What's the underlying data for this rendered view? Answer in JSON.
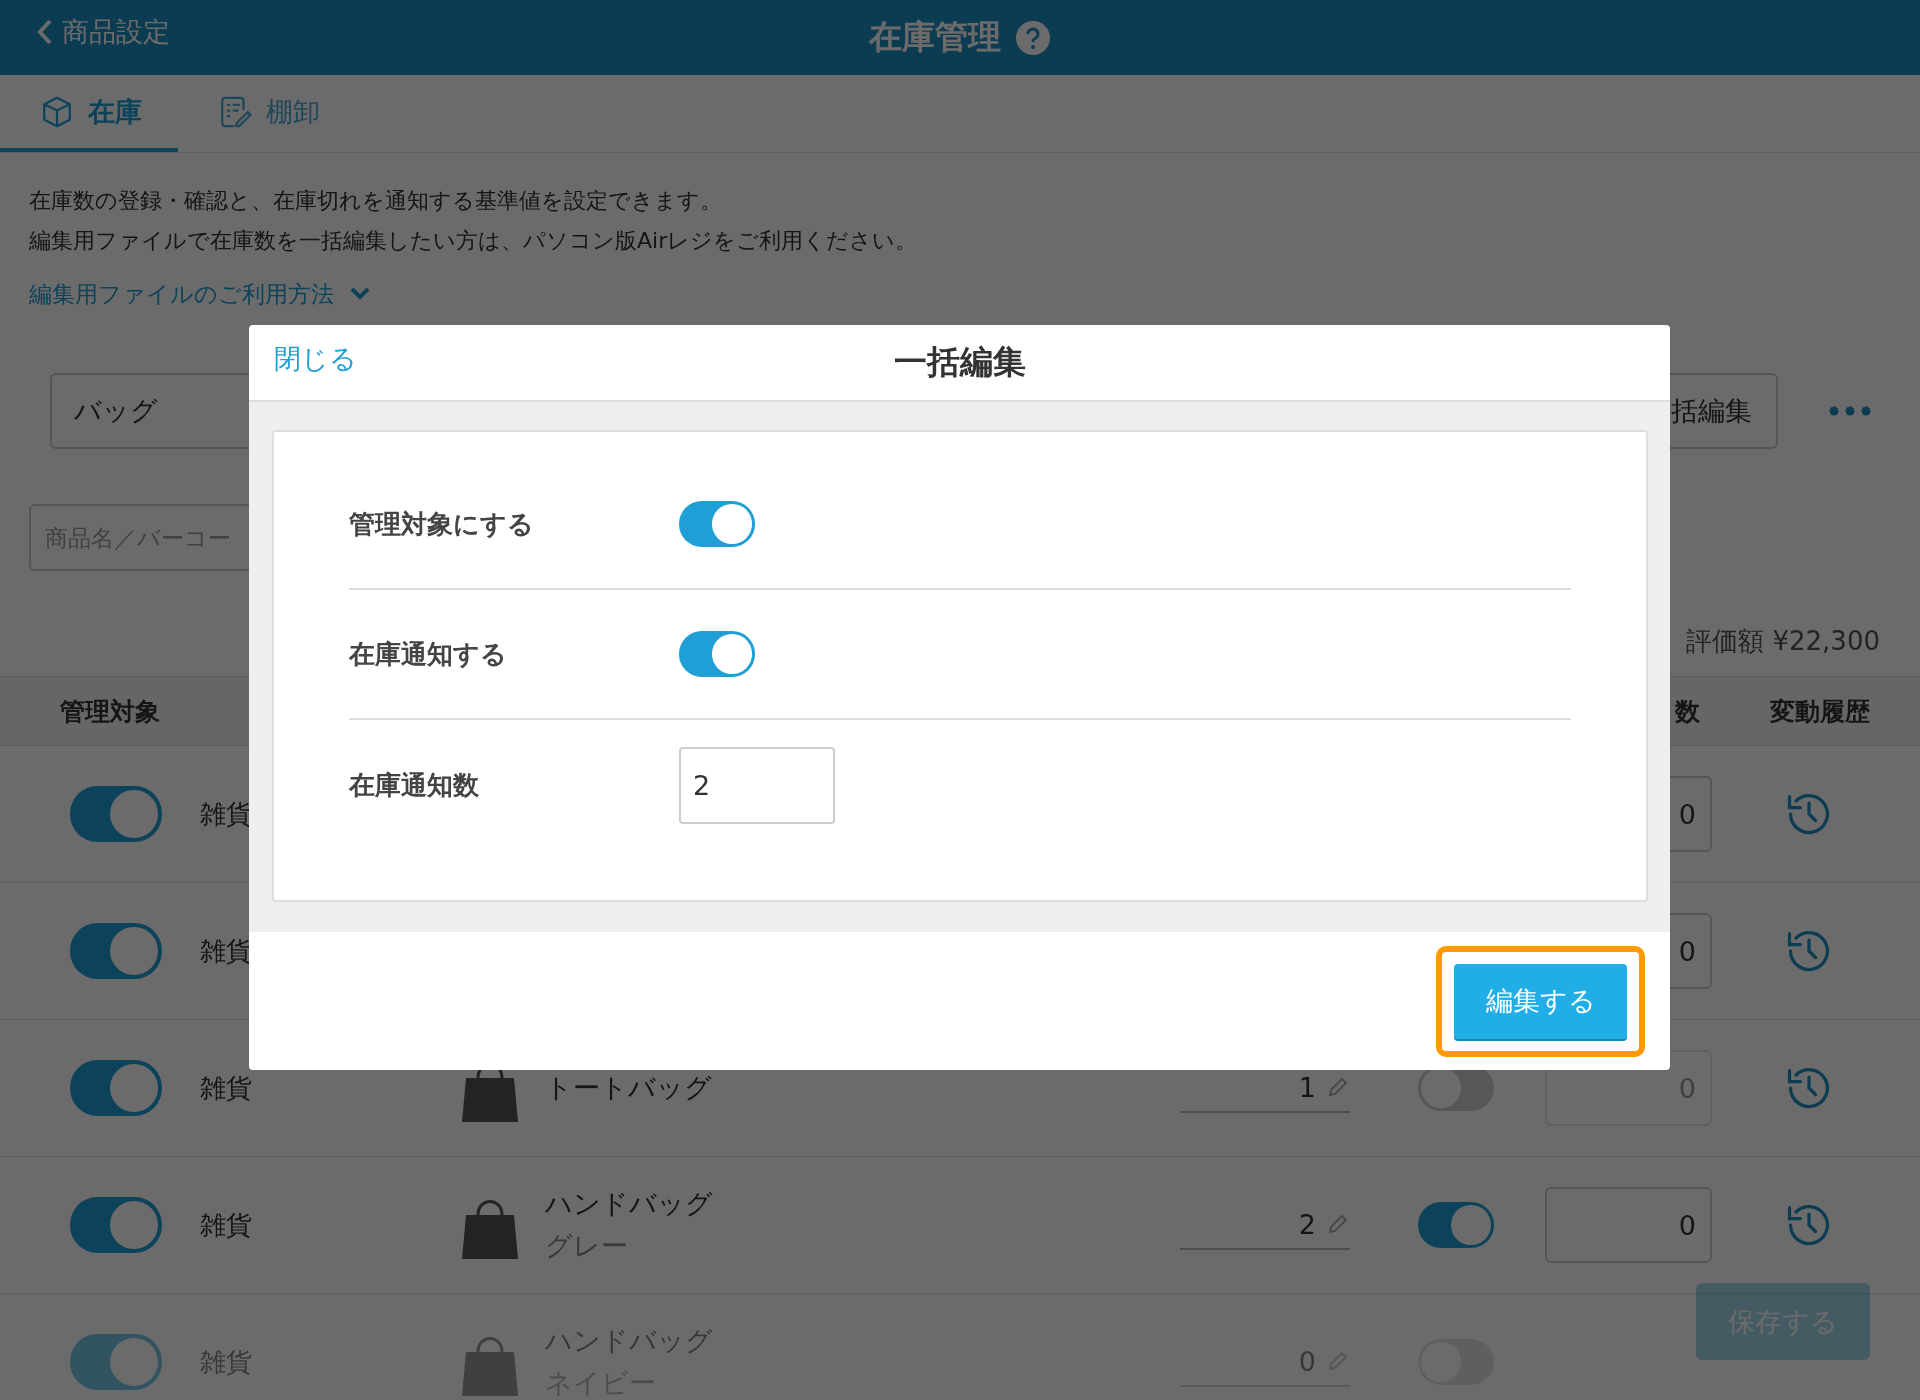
{
  "header": {
    "back_label": "商品設定",
    "title": "在庫管理"
  },
  "tabs": [
    {
      "label": "在庫",
      "selected": true,
      "kind": "stock"
    },
    {
      "label": "棚卸",
      "selected": false,
      "kind": "inventory"
    }
  ],
  "intro": {
    "lines": [
      "在庫数の登録・確認と、在庫切れを通知する基準値を設定できます。",
      "編集用ファイルで在庫数を一括編集したい方は、パソコン版Airレジをご利用ください。"
    ],
    "help_link": "編集用ファイルのご利用方法"
  },
  "toolbar": {
    "category": "バッグ",
    "bulk_edit": "括編集"
  },
  "search": {
    "placeholder": "商品名／バーコー"
  },
  "summary": "評価額 ¥22,300",
  "table": {
    "columns": [
      {
        "kind": "managed",
        "label": "管理対象"
      },
      {
        "kind": "notify_count",
        "label": "数"
      },
      {
        "kind": "history",
        "label": "変動履歴"
      }
    ],
    "rows": [
      {
        "managed": true,
        "category": "雑貨",
        "notify_count": "0"
      },
      {
        "managed": true,
        "category": "雑貨",
        "notify_count": "0"
      },
      {
        "managed": true,
        "category": "雑貨",
        "product": [
          "トートバッグ"
        ],
        "stock": "1",
        "notify": false,
        "notify_count": "0"
      },
      {
        "managed": true,
        "category": "雑貨",
        "product": [
          "ハンドバッグ",
          "グレー"
        ],
        "stock": "2",
        "notify": true,
        "notify_count": "0"
      },
      {
        "managed": true,
        "category": "雑貨",
        "product": [
          "ハンドバッグ",
          "ネイビー"
        ],
        "stock": "0",
        "notify": false,
        "faded": true
      }
    ]
  },
  "footer": {
    "save": "保存する",
    "disabled": true
  },
  "modal": {
    "close": "閉じる",
    "title": "一括編集",
    "settings": [
      {
        "kind": "toggle",
        "label": "管理対象にする",
        "on": true
      },
      {
        "kind": "toggle",
        "label": "在庫通知する",
        "on": true
      },
      {
        "kind": "number",
        "label": "在庫通知数",
        "value": "2"
      }
    ],
    "submit": {
      "label": "編集する",
      "highlighted": true
    }
  }
}
